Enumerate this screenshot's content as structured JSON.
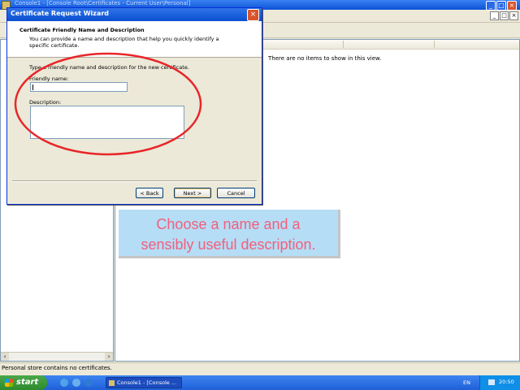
{
  "mmc": {
    "title": "Console1 - [Console Root\\Certificates - Current User\\Personal]",
    "empty_message": "There are no items to show in this view.",
    "status": "Personal store contains no certificates."
  },
  "callout": {
    "line1": "Choose a name and a",
    "line2": "sensibly useful description."
  },
  "wizard": {
    "title": "Certificate Request Wizard",
    "header_title": "Certificate Friendly Name and Description",
    "header_subtitle": "You can provide a name and description that help you quickly identify a specific certificate.",
    "intro": "Type a friendly name and description for the new certificate.",
    "friendly_name_label": "Friendly name:",
    "friendly_name_value": "",
    "description_label": "Description:",
    "description_value": "",
    "back_label": "< Back",
    "next_label": "Next >",
    "cancel_label": "Cancel"
  },
  "taskbar": {
    "start_label": "start",
    "task_label": "Console1 - [Console ...",
    "language": "EN",
    "clock": "20:50"
  },
  "colors": {
    "annotation_ellipse": "#e8262a",
    "callout_bg": "#b6ddf6",
    "callout_text": "#f0607c"
  }
}
